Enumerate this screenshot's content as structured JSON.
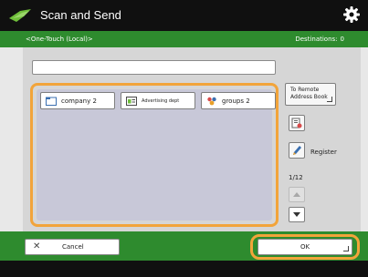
{
  "app": {
    "title": "Scan and Send"
  },
  "subheader": {
    "mode_label": "<One-Touch (Local)>",
    "destinations_label": "Destinations:",
    "destinations_count": "0"
  },
  "address_input": {
    "value": "",
    "placeholder": ""
  },
  "destinations": [
    {
      "label": "company 2",
      "icon": "folder-icon"
    },
    {
      "label": "Advertising dept",
      "icon": "address-card-icon"
    },
    {
      "label": "groups 2",
      "icon": "group-icon"
    }
  ],
  "side_buttons": {
    "remote_address_book": "To Remote Address Book",
    "details_icon": "details-icon",
    "register_icon": "register-pen-icon",
    "register_label": "Register",
    "page_indicator": "1/12"
  },
  "footer": {
    "cancel_label": "Cancel",
    "ok_label": "OK"
  },
  "colors": {
    "accent_orange": "#f2a43a",
    "bar_green": "#2e8b2e",
    "title_bg": "#101010",
    "list_bg": "#c8c8d8"
  }
}
